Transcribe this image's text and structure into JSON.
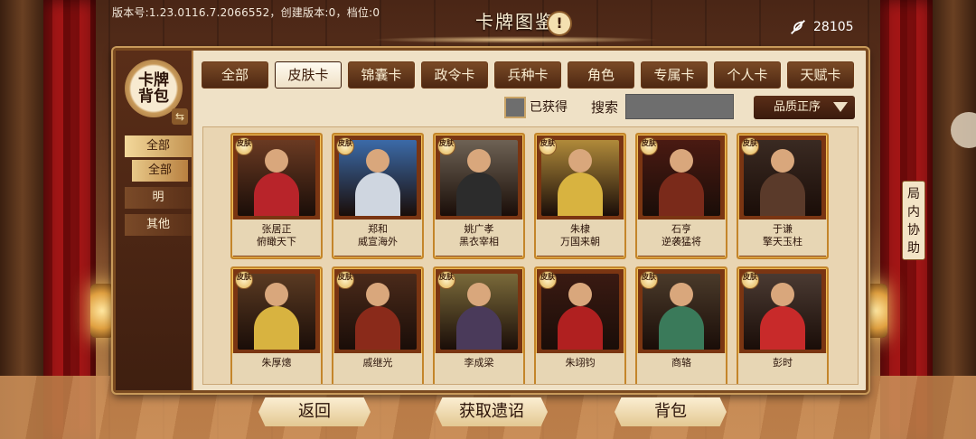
{
  "status": {
    "version": "版本号:1.23.0116.7.2066552，创建版本:0，档位:0"
  },
  "header": {
    "title": "卡牌图鉴",
    "info_icon": "exclamation-icon",
    "currency_icon": "feather-icon",
    "currency_value": "28105"
  },
  "sidebar": {
    "logo": "卡牌背包",
    "items": [
      {
        "label": "全部",
        "state": "active"
      },
      {
        "label": "全部",
        "state": "sub"
      },
      {
        "label": "明",
        "state": "normal"
      },
      {
        "label": "其他",
        "state": "normal"
      }
    ]
  },
  "tabs": [
    {
      "label": "全部",
      "active": false
    },
    {
      "label": "皮肤卡",
      "active": true
    },
    {
      "label": "锦囊卡",
      "active": false
    },
    {
      "label": "政令卡",
      "active": false
    },
    {
      "label": "兵种卡",
      "active": false
    },
    {
      "label": "角色",
      "active": false
    },
    {
      "label": "专属卡",
      "active": false
    },
    {
      "label": "个人卡",
      "active": false
    },
    {
      "label": "天赋卡",
      "active": false
    }
  ],
  "filters": {
    "owned_label": "已获得",
    "search_label": "搜索",
    "search_value": "",
    "sort_label": "品质正序"
  },
  "badge": "皮肤",
  "cards": [
    {
      "name": "张居正",
      "title": "俯瞰天下",
      "color": "#b8242a",
      "bg": "#6a3a22"
    },
    {
      "name": "郑和",
      "title": "威宣海外",
      "color": "#cfd6e0",
      "bg": "#3b6aa8"
    },
    {
      "name": "姚广孝",
      "title": "黑衣宰相",
      "color": "#2c2c2c",
      "bg": "#6e6254"
    },
    {
      "name": "朱棣",
      "title": "万国来朝",
      "color": "#d8b340",
      "bg": "#b08a3a"
    },
    {
      "name": "石亨",
      "title": "逆袭猛将",
      "color": "#7a2a1a",
      "bg": "#4a1a12"
    },
    {
      "name": "于谦",
      "title": "擎天玉柱",
      "color": "#5a3a2a",
      "bg": "#3a2a22"
    },
    {
      "name": "朱厚熜",
      "title": "",
      "color": "#d8b340",
      "bg": "#5a3a22"
    },
    {
      "name": "戚继光",
      "title": "",
      "color": "#8a2a1a",
      "bg": "#4a2a1a"
    },
    {
      "name": "李成梁",
      "title": "",
      "color": "#4a3a5a",
      "bg": "#7a6a3a"
    },
    {
      "name": "朱翊钧",
      "title": "",
      "color": "#b02020",
      "bg": "#3a1a12"
    },
    {
      "name": "商辂",
      "title": "",
      "color": "#3a7a5a",
      "bg": "#4a3a2a"
    },
    {
      "name": "彭时",
      "title": "",
      "color": "#c82a2a",
      "bg": "#4a3a32"
    }
  ],
  "assist": "局内协助",
  "buttons": {
    "back": "返回",
    "get": "获取遗诏",
    "bag": "背包"
  }
}
